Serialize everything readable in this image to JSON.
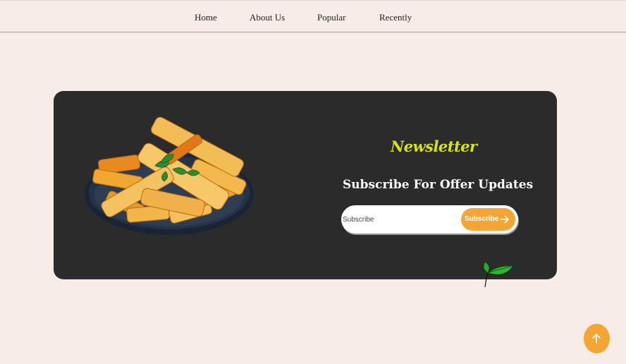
{
  "nav": {
    "items": [
      {
        "label": "Home"
      },
      {
        "label": "About Us"
      },
      {
        "label": "Popular"
      },
      {
        "label": "Recently"
      }
    ]
  },
  "newsletter": {
    "title": "Newsletter",
    "heading": "Subscribe For Offer Updates",
    "input_placeholder": "Subscribe",
    "button_label": "Subscribe",
    "button_icon": "arrow-right-icon",
    "image": "fries-plate-image",
    "decoration_icon": "leaf-icon"
  },
  "scroll_top": {
    "icon": "arrow-up-icon"
  },
  "colors": {
    "background": "#f8ede6",
    "card": "#2b2b2b",
    "accent": "#f5a534",
    "title": "#d9e021"
  }
}
